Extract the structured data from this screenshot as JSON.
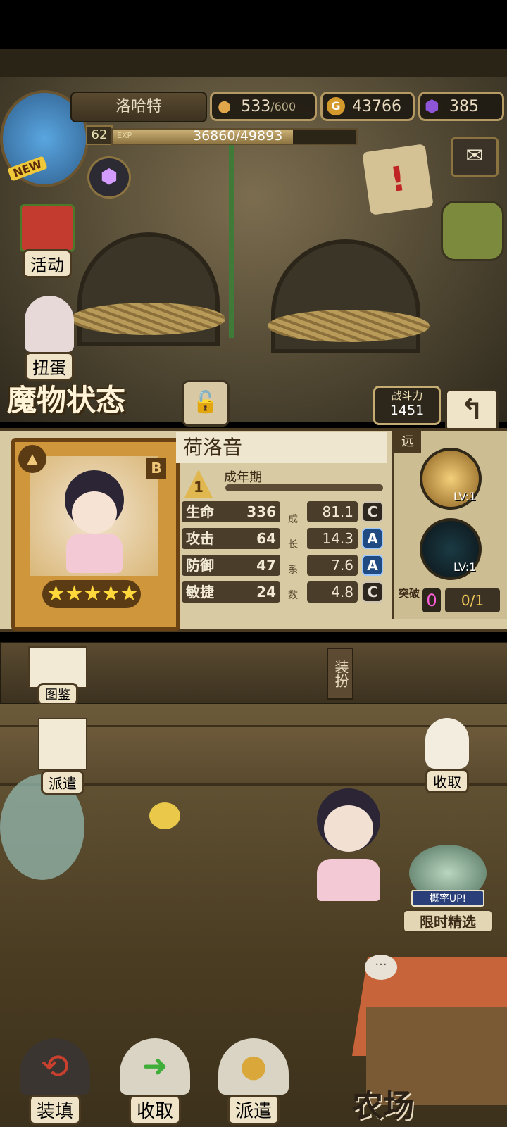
{
  "player": {
    "name": "洛哈特",
    "level": "62",
    "exp_label": "EXP",
    "exp_text": "36860/49893",
    "exp_fraction": 0.739,
    "new_badge": "NEW"
  },
  "resources": {
    "stamina": "533",
    "stamina_max": "/600",
    "gold_icon": "G",
    "gold": "43766",
    "gems": "385"
  },
  "left_menu": {
    "activity": "活动",
    "gacha": "扭蛋"
  },
  "panel": {
    "title": "魔物状态",
    "power_label": "战斗力",
    "power_value": "1451",
    "monster_name": "荷洛音",
    "rarity": "B",
    "stage_number": "1",
    "stage": "成年期",
    "range_tag": "远",
    "growth_label": [
      "成",
      "长",
      "系",
      "数"
    ],
    "stats": [
      {
        "name": "生命",
        "value": "336",
        "growth": "81.1",
        "grade": "C"
      },
      {
        "name": "攻击",
        "value": "64",
        "growth": "14.3",
        "grade": "A"
      },
      {
        "name": "防御",
        "value": "47",
        "growth": "7.6",
        "grade": "A"
      },
      {
        "name": "敏捷",
        "value": "24",
        "growth": "4.8",
        "grade": "C"
      }
    ],
    "skill1_level": "LV:1",
    "skill2_level": "LV:1",
    "breakthrough_label": "突破",
    "breakthrough_value": "0",
    "breakthrough_progress": "0/1",
    "stars": 5
  },
  "actions": {
    "codex": "图鉴",
    "outfit": "装扮",
    "dispatch": "派遣",
    "collect": "收取"
  },
  "event": {
    "rate_up": "概率UP!",
    "limited": "限时精选"
  },
  "bottom_nav": {
    "load": "装填",
    "collect": "收取",
    "dispatch": "派遣",
    "farm": "农场"
  }
}
